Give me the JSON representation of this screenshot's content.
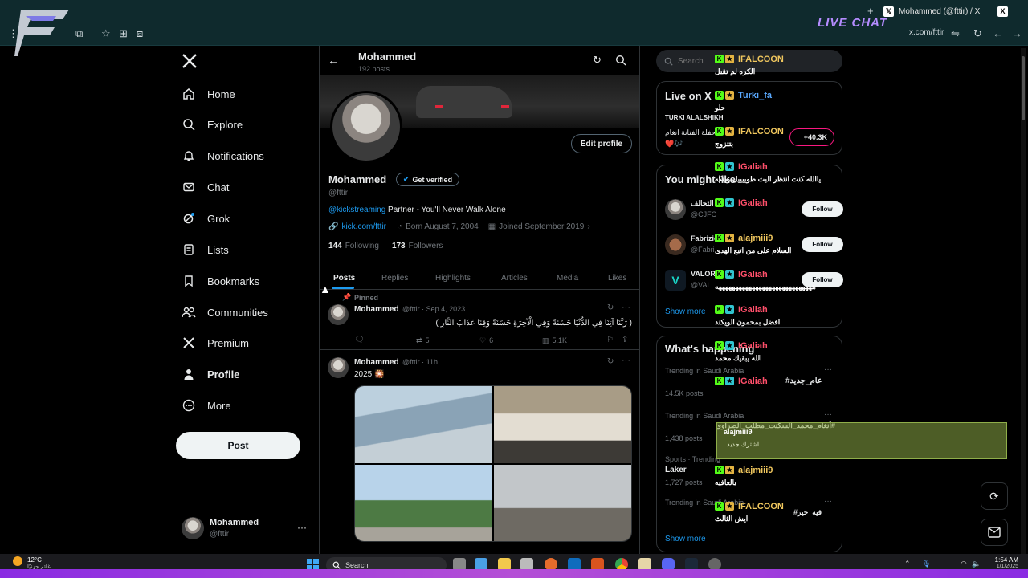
{
  "browser": {
    "tab_title": "Mohammed (@fttir) / X",
    "tab_close": "X",
    "url": "x.com/fttir",
    "live_chat": "LIVE CHAT"
  },
  "nav": {
    "items": [
      {
        "label": "Home",
        "icon": "home-icon"
      },
      {
        "label": "Explore",
        "icon": "search-icon"
      },
      {
        "label": "Notifications",
        "icon": "bell-icon"
      },
      {
        "label": "Chat",
        "icon": "mail-icon"
      },
      {
        "label": "Grok",
        "icon": "grok-icon"
      },
      {
        "label": "Lists",
        "icon": "list-icon"
      },
      {
        "label": "Bookmarks",
        "icon": "bookmark-icon"
      },
      {
        "label": "Communities",
        "icon": "people-icon"
      },
      {
        "label": "Premium",
        "icon": "x-logo-icon"
      },
      {
        "label": "Profile",
        "icon": "person-icon"
      },
      {
        "label": "More",
        "icon": "more-circle-icon"
      }
    ],
    "post_label": "Post",
    "account_name": "Mohammed",
    "account_handle": "@fttir",
    "account_more": "···"
  },
  "profile": {
    "header_name": "Mohammed",
    "post_count": "192 posts",
    "edit_label": "Edit profile",
    "name": "Mohammed",
    "verify_label": "Get verified",
    "handle": "@fttir",
    "bio_link": "@kickstreaming",
    "bio_text": " Partner - You'll Never Walk Alone",
    "website": "kick.com/fttir",
    "born": "Born August 7, 2004",
    "joined": "Joined September 2019",
    "following_count": "144",
    "following_label": "Following",
    "followers_count": "173",
    "followers_label": "Followers",
    "tabs": [
      "Posts",
      "Replies",
      "Highlights",
      "Articles",
      "Media",
      "Likes"
    ]
  },
  "posts": [
    {
      "pinned": "Pinned",
      "name": "Mohammed",
      "meta": "@fttir · Sep 4, 2023",
      "text": "( رَبَّنَا آتِنَا فِي الدُّنْيَا حَسَنَةً وَفِي الْآخِرَةِ حَسَنَةً وَقِنَا عَذَابَ النَّارِ )",
      "reposts": "5",
      "likes": "6",
      "views": "5.1K"
    },
    {
      "name": "Mohammed",
      "meta": "@fttir · 11h",
      "text": "2025 🎇"
    }
  ],
  "right": {
    "search_placeholder": "Search",
    "live_title": "Live on X",
    "live_host": "TURKI ALALSHIKH",
    "live_text": "حفلة الفنانة انغام",
    "live_emojis": "❤️🎶",
    "live_count": "+40.3K",
    "follow_title": "You might like",
    "suggestions": [
      {
        "name": "التحالف",
        "handle": "@CJFC"
      },
      {
        "name": "Fabrizio",
        "handle": "@Fabri"
      },
      {
        "name": "VALORA",
        "handle": "@VAL"
      }
    ],
    "follow_label": "Follow",
    "show_more": "Show more",
    "trends_title": "What's happening",
    "trends": [
      {
        "context": "Trending in Saudi Arabia",
        "name": "#عام_جديد",
        "count": "14.5K posts"
      },
      {
        "context": "Trending in Saudi Arabia",
        "name": "#أنغام_محمد_السكنت_مطلب_الصراوي",
        "count": "1,438 posts"
      },
      {
        "context": "Sports · Trending",
        "name": "Laker",
        "count": "1,727 posts"
      },
      {
        "context": "Trending in Saudi Arabia",
        "name": "#فيه_خير",
        "count": ""
      }
    ]
  },
  "chat": [
    {
      "user": "IFALCOON",
      "color": "#f0c75e",
      "msg": "الكره لم تقبل"
    },
    {
      "user": "Turki_fa",
      "color": "#5aa9ff",
      "msg": "حلو"
    },
    {
      "user": "IFALCOON",
      "color": "#f0c75e",
      "msg": "بتتزوج"
    },
    {
      "user": "IGaliah",
      "color": "#ff4f6a",
      "msg": "ياالله كنت انتظر البث طوييييل وينكه"
    },
    {
      "user": "IGaliah",
      "color": "#ff4f6a",
      "msg": ""
    },
    {
      "user": "alajmiii9",
      "color": "#f0c75e",
      "msg": "السلام على من اتبع الهدى"
    },
    {
      "user": "IGaliah",
      "color": "#ff4f6a",
      "msg": "هههههههههههههههههههههههههههههه"
    },
    {
      "user": "IGaliah",
      "color": "#ff4f6a",
      "msg": "افضل بمحمون الويكند"
    },
    {
      "user": "IGaliah",
      "color": "#ff4f6a",
      "msg": "الله يبقيك محمد"
    },
    {
      "user": "IGaliah",
      "color": "#ff4f6a",
      "msg": ""
    },
    {
      "user": "alajmiii9",
      "color": "#f0c75e",
      "msg": "بالعافيه"
    },
    {
      "user": "IFALCOON",
      "color": "#f0c75e",
      "msg": "ايش الثالث"
    }
  ],
  "alert": {
    "user": "alajmiii9",
    "text": "اشترك جديد"
  },
  "taskbar": {
    "weather_temp": "12°C",
    "weather_desc": "غائم جزئيًا",
    "search_label": "Search",
    "time": "1:54 AM",
    "date": "1/1/2025"
  }
}
